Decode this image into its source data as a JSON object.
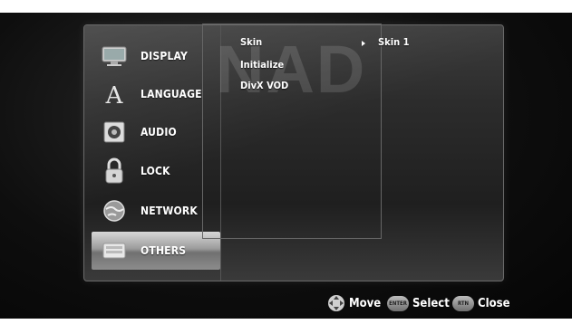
{
  "watermark": "NAD",
  "sidebar": {
    "items": [
      {
        "label": "DISPLAY",
        "icon": "display-icon"
      },
      {
        "label": "LANGUAGE",
        "icon": "language-icon"
      },
      {
        "label": "AUDIO",
        "icon": "audio-icon"
      },
      {
        "label": "LOCK",
        "icon": "lock-icon"
      },
      {
        "label": "NETWORK",
        "icon": "network-icon"
      },
      {
        "label": "OTHERS",
        "icon": "others-icon",
        "selected": true
      }
    ]
  },
  "options": [
    {
      "label": "Skin",
      "value": "Skin 1"
    },
    {
      "label": "Initialize"
    },
    {
      "label": "DivX VOD"
    }
  ],
  "footer": {
    "move_label": "Move",
    "select_label": "Select",
    "select_button": "ENTER",
    "close_label": "Close",
    "close_button": "RTN"
  }
}
